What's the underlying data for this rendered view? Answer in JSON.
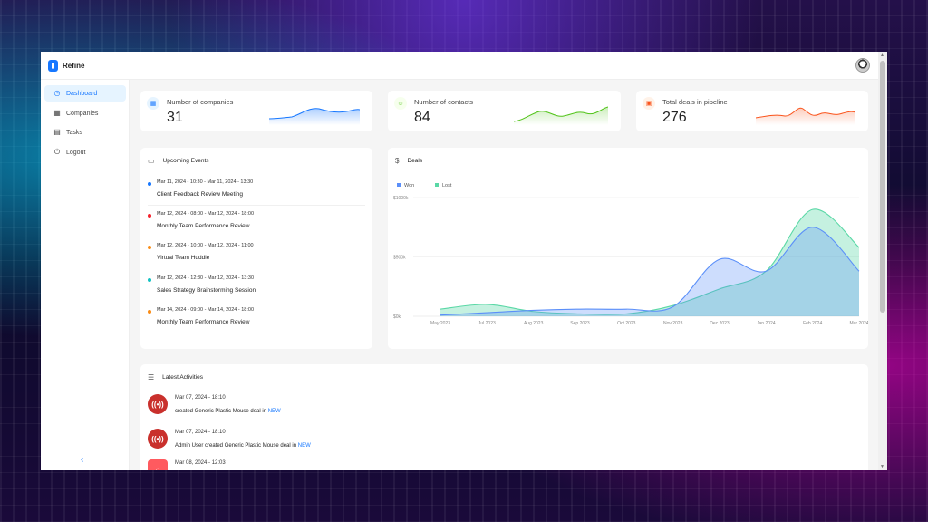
{
  "app": {
    "title": "Refine"
  },
  "sidebar": {
    "items": [
      {
        "label": "Dashboard",
        "icon": "dashboard-icon",
        "active": true
      },
      {
        "label": "Companies",
        "icon": "shop-icon",
        "active": false
      },
      {
        "label": "Tasks",
        "icon": "project-icon",
        "active": false
      },
      {
        "label": "Logout",
        "icon": "logout-icon",
        "active": false
      }
    ]
  },
  "kpis": [
    {
      "label": "Number of companies",
      "value": "31",
      "color": "#1677ff",
      "icon_bg": "#e6f4ff",
      "icon": "shop-icon"
    },
    {
      "label": "Number of contacts",
      "value": "84",
      "color": "#52c41a",
      "icon_bg": "#f6ffed",
      "icon": "team-icon"
    },
    {
      "label": "Total deals in pipeline",
      "value": "276",
      "color": "#fa541c",
      "icon_bg": "#fff2e8",
      "icon": "audit-icon"
    }
  ],
  "events": {
    "title": "Upcoming Events",
    "items": [
      {
        "date": "Mar 11, 2024 - 10:30 - Mar 11, 2024 - 13:30",
        "title": "Client Feedback Review Meeting",
        "color": "#1677ff"
      },
      {
        "date": "Mar 12, 2024 - 08:00 - Mar 12, 2024 - 18:00",
        "title": "Monthly Team Performance Review",
        "color": "#f5222d"
      },
      {
        "date": "Mar 12, 2024 - 10:00 - Mar 12, 2024 - 11:00",
        "title": "Virtual Team Huddle",
        "color": "#fa8c16"
      },
      {
        "date": "Mar 12, 2024 - 12:30 - Mar 12, 2024 - 13:30",
        "title": "Sales Strategy Brainstorming Session",
        "color": "#13c2c2"
      },
      {
        "date": "Mar 14, 2024 - 09:00 - Mar 14, 2024 - 18:00",
        "title": "Monthly Team Performance Review",
        "color": "#fa8c16"
      }
    ]
  },
  "deals": {
    "title": "Deals"
  },
  "chart_data": {
    "type": "area",
    "categories": [
      "May 2023",
      "Jul 2023",
      "Aug 2023",
      "Sep 2023",
      "Oct 2023",
      "Nov 2023",
      "Dec 2023",
      "Jan 2024",
      "Feb 2024",
      "Mar 2024"
    ],
    "series": [
      {
        "name": "Won",
        "color": "#5b8ff9",
        "values": [
          10,
          30,
          50,
          60,
          60,
          80,
          480,
          380,
          750,
          380
        ]
      },
      {
        "name": "Lost",
        "color": "#5ad8a6",
        "values": [
          60,
          100,
          40,
          20,
          20,
          90,
          230,
          380,
          900,
          580
        ]
      }
    ],
    "ylim": [
      0,
      1000
    ],
    "yticks": [
      "$0k",
      "$500k",
      "$1000k"
    ],
    "legend": "top-left",
    "grid": true
  },
  "activities": {
    "title": "Latest Activities",
    "items": [
      {
        "time": "Mar 07, 2024 - 18:10",
        "prefix": " created Generic Plastic Mouse deal in ",
        "stage": "NEW",
        "icon": "company-logo-icon",
        "square": false
      },
      {
        "time": "Mar 07, 2024 - 18:10",
        "prefix": "Admin User created Generic Plastic Mouse deal in ",
        "stage": "NEW",
        "icon": "company-logo-icon",
        "square": false
      },
      {
        "time": "Mar 08, 2024 - 12:03",
        "prefix": "",
        "stage": "",
        "icon": "airbnb-logo-icon",
        "square": true
      }
    ]
  }
}
